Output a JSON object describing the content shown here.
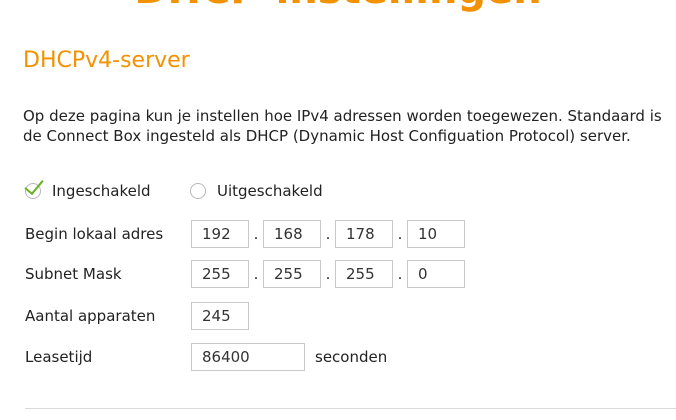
{
  "header": {
    "title": "DHCP-instellingen"
  },
  "section": {
    "title": "DHCPv4-server",
    "description": "Op deze pagina kun je instellen hoe IPv4 adressen worden toegewezen. Standaard is de Connect Box ingesteld als DHCP (Dynamic Host Configuation Protocol) server."
  },
  "mode": {
    "enabled_label": "Ingeschakeld",
    "disabled_label": "Uitgeschakeld",
    "selected": "enabled"
  },
  "form": {
    "start_address": {
      "label": "Begin lokaal adres",
      "octets": [
        "192",
        "168",
        "178",
        "10"
      ]
    },
    "subnet_mask": {
      "label": "Subnet Mask",
      "octets": [
        "255",
        "255",
        "255",
        "0"
      ]
    },
    "device_count": {
      "label": "Aantal apparaten",
      "value": "245"
    },
    "lease_time": {
      "label": "Leasetijd",
      "value": "86400",
      "unit": "seconden"
    },
    "separator": "."
  },
  "colors": {
    "accent": "#f39200",
    "check": "#6ab023",
    "border": "#c8c8c8"
  },
  "icons": {
    "enabled": "checkmark-icon",
    "disabled": "radio-empty-icon"
  }
}
